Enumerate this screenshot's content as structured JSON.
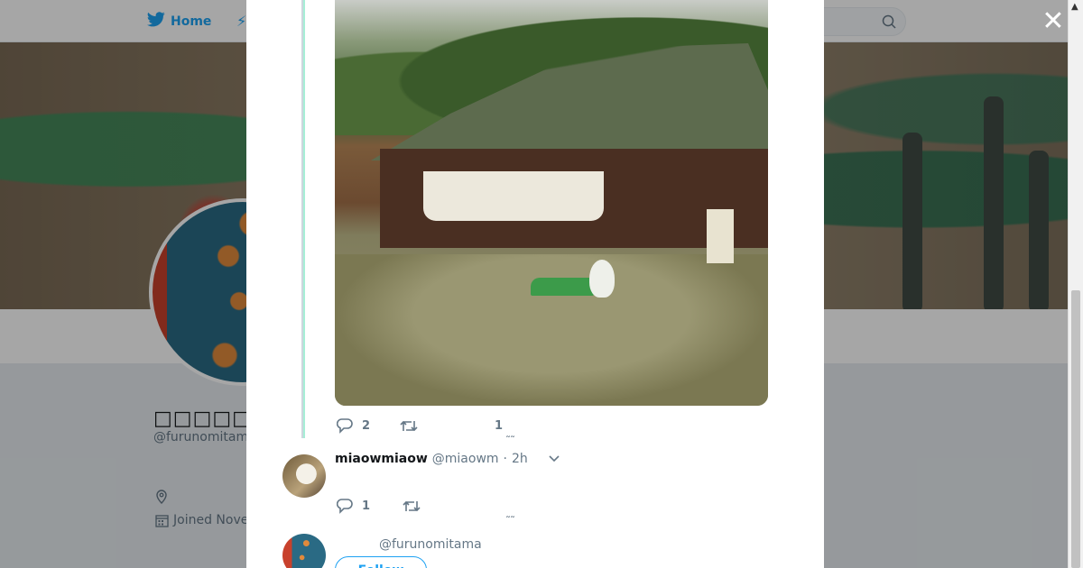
{
  "nav": {
    "home_label": "Home"
  },
  "profile": {
    "name": "□□□□□□□□□□",
    "handle": "@furunomitama",
    "joined": "Joined Nove"
  },
  "modal": {
    "first_tweet_actions": {
      "replies": "2",
      "retweets": "",
      "likes": "1"
    },
    "reply_tweet": {
      "name": "miaowmiaow",
      "handle": "@miaowm",
      "dot": "·",
      "time": "2h",
      "replies": "1",
      "retweets": ""
    },
    "next_tweet": {
      "handle": "@furunomitama",
      "follow_label": "Follow"
    }
  },
  "icons": {
    "close": "close-icon",
    "scroll_up": "▲"
  },
  "colors": {
    "accent": "#1da1f2",
    "thread": "#a6eed6"
  }
}
